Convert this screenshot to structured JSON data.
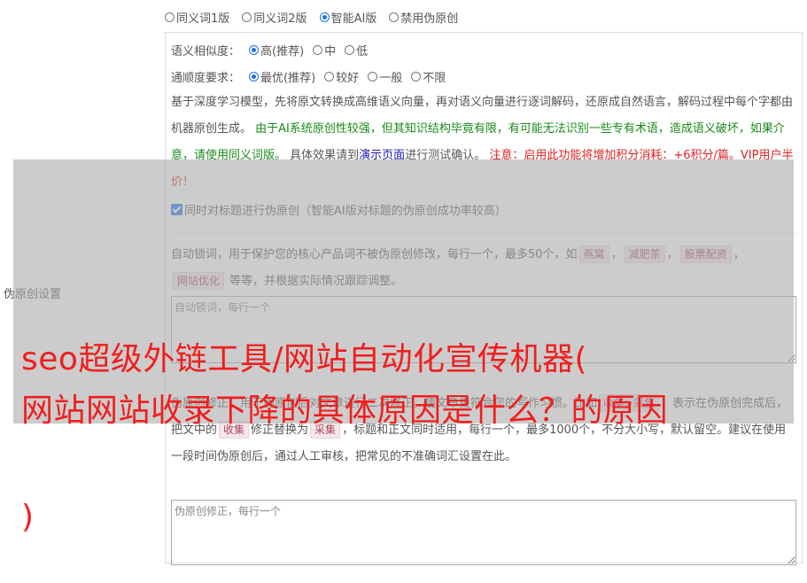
{
  "mode": {
    "options": [
      "同义词1版",
      "同义词2版",
      "智能AI版",
      "禁用伪原创"
    ],
    "selected_index": 2
  },
  "left_label": "伪原创设置",
  "similarity": {
    "label": "语义相似度：",
    "options": [
      "高(推荐)",
      "中",
      "低"
    ],
    "selected_index": 0
  },
  "fluency": {
    "label": "通顺度要求：",
    "options": [
      "最优(推荐)",
      "较好",
      "一般",
      "不限"
    ],
    "selected_index": 0
  },
  "description": {
    "part1": "基于深度学习模型，先将原文转换成高维语义向量，再对语义向量进行逐词解码，还原成自然语言，解码过程中每个字都由机器原创生成。",
    "green": "由于AI系统原创性较强，但其知识结构毕竟有限，有可能无法识别一些专有术语，造成语义破坏，如果介意，请使用同义词版。",
    "part2": "具体效果请到",
    "link": "演示页面",
    "part3": "进行测试确认。",
    "red": "注意：启用此功能将增加积分消耗：+6积分/篇。VIP用户半价！"
  },
  "title_checkbox": {
    "label": "同时对标题进行伪原创（智能AI版对标题的伪原创成功率较高）",
    "checked": true
  },
  "lock_words": {
    "text1": "自动锁词，用于保护您的核心产品词不被伪原创修改，每行一个，最多50个，如",
    "tags": [
      "燕窝",
      "减肥茶",
      "股票配资",
      "网站优化"
    ],
    "text2": "等等，并根据实际情况跟踪调整。",
    "placeholder": "自动锁词，每行一个"
  },
  "correction": {
    "text1": "伪原创修正，用于伪原创后对文章进行二次修正，使文章更符合您的写作习惯。比如",
    "tag1": "收集>采集",
    "text2": "，表示在伪原创完成后，把文中的",
    "tag2": "收集",
    "text3": "修正替换为",
    "tag3": "采集",
    "text4": "，标题和正文同时适用，每行一个，最多1000个，不分大小写，默认留空。建议在使用一段时间伪原创后，通过人工审核，把常见的不准确词汇设置在此。",
    "placeholder": "伪原创修正，每行一个"
  },
  "overlay_title": {
    "line1": "seo超级外链工具/网站自动化宣传机器(",
    "line2": "网站网站收录下降的具体原因是什么？的原因",
    "line3": ")"
  },
  "colors": {
    "accent": "#1a73e8",
    "overlay_text": "#f21d1d",
    "green_note": "#1a8a1a",
    "red_note": "#dd2222",
    "tag_bg": "#f3e8ec"
  }
}
